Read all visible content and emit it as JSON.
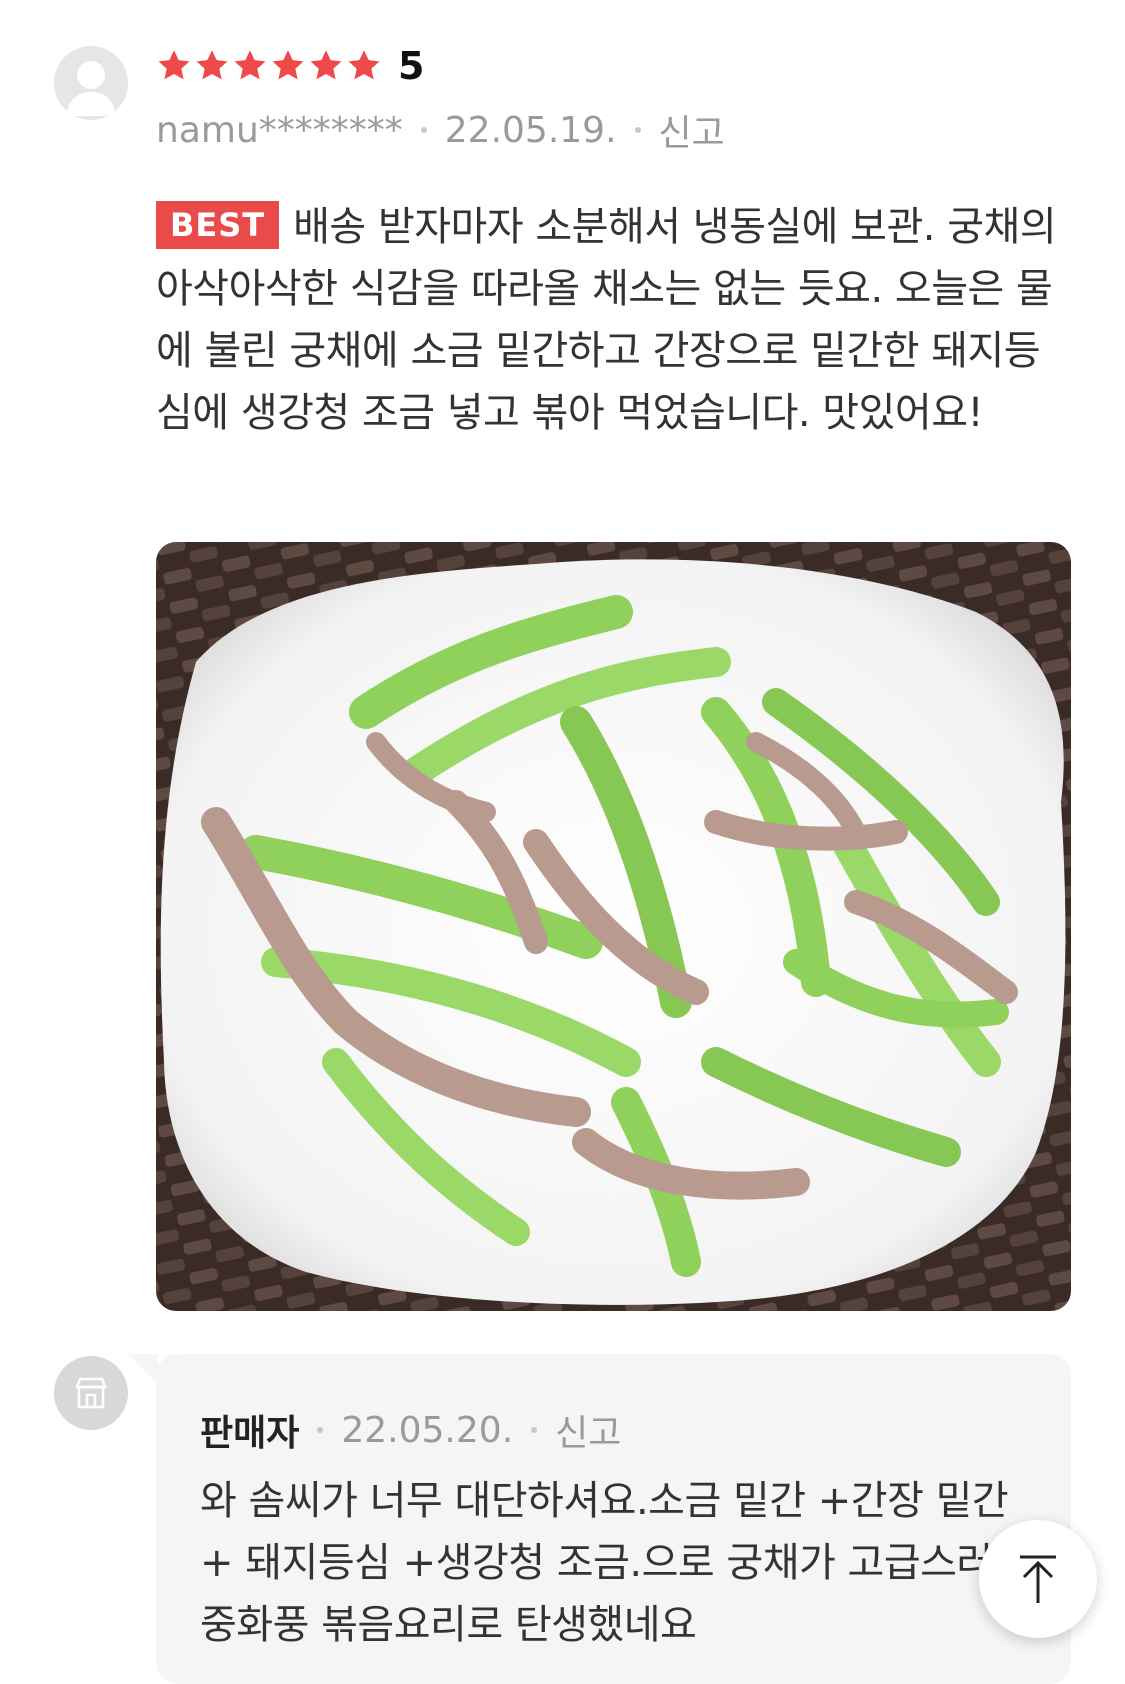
{
  "review": {
    "rating_text": "5",
    "star_count": 6,
    "star_color": "#ee4a4a",
    "username": "namu********",
    "date": "22.05.19.",
    "report_label": "신고",
    "best_badge": "BEST",
    "badge_color": "#e94b4b",
    "body": "배송 받자마자 소분해서 냉동실에 보관. 궁채의 아삭아삭한 식감을 따라올 채소는 없는 듯요. 오늘은 물에 불린 궁채에 소금 밑간하고 간장으로 밑간한 돼지등심에 생강청 조금 넣고 볶아 먹었습니다. 맛있어요!",
    "photo_icon": "food-photo"
  },
  "seller_reply": {
    "icon": "store-icon",
    "name": "판매자",
    "date": "22.05.20.",
    "report_label": "신고",
    "body": "와 솜씨가 너무 대단하셔요.소금 밑간 +간장 밑간+ 돼지등심 +생강청 조금.으로 궁채가 고급스러운 중화풍 볶음요리로 탄생했네요"
  },
  "scroll_top_icon": "arrow-up-icon"
}
